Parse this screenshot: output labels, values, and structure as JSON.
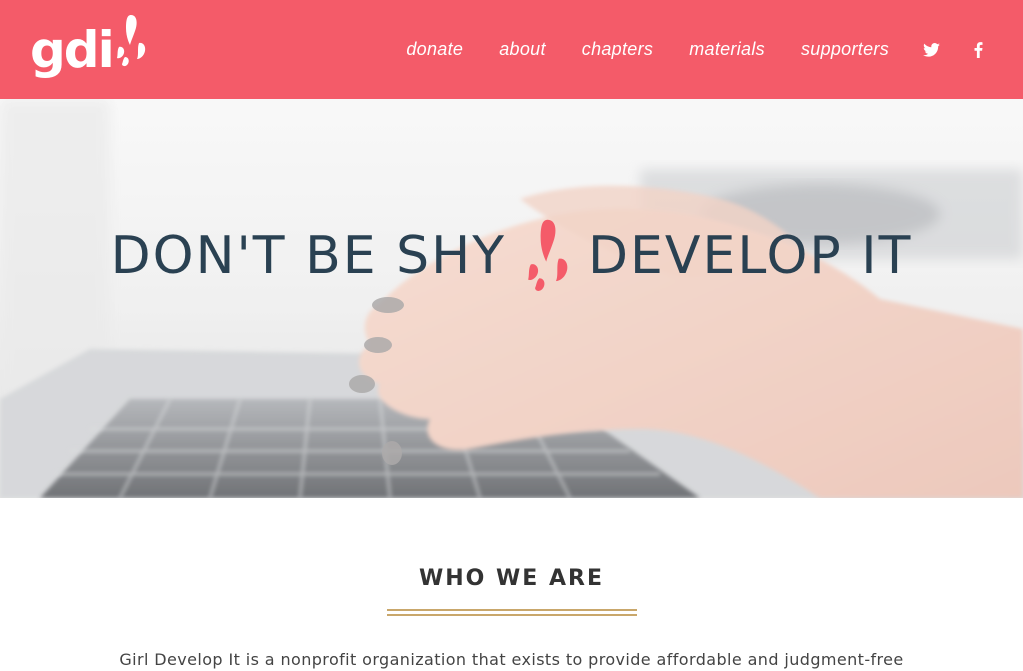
{
  "header": {
    "logo_text": "gdi",
    "nav": [
      {
        "label": "donate"
      },
      {
        "label": "about"
      },
      {
        "label": "chapters"
      },
      {
        "label": "materials"
      },
      {
        "label": "supporters"
      }
    ],
    "social": [
      "twitter-icon",
      "facebook-icon"
    ],
    "bg_color": "#f45b69"
  },
  "hero": {
    "title_left": "DON'T BE SHY",
    "title_right": "DEVELOP IT",
    "title_color": "#2a4152",
    "accent_color": "#f45b69"
  },
  "about": {
    "title": "WHO WE ARE",
    "rule_color": "#c9a76b",
    "text": "Girl Develop It is a nonprofit organization that exists to provide affordable and judgment-free"
  }
}
